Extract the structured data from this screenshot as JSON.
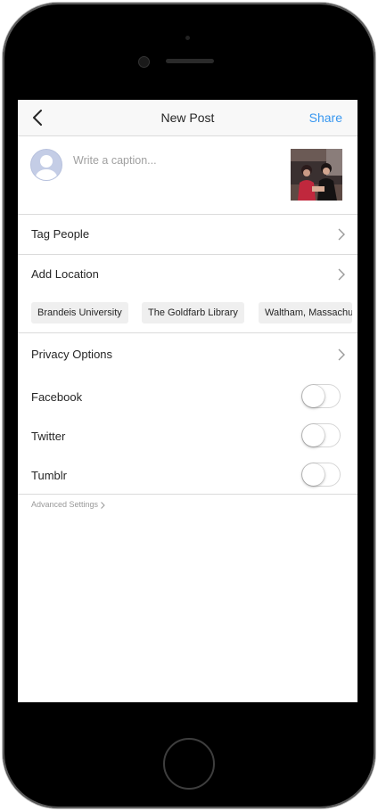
{
  "nav": {
    "title": "New Post",
    "share_label": "Share"
  },
  "caption": {
    "placeholder": "Write a caption..."
  },
  "rows": {
    "tag_people": "Tag People",
    "add_location": "Add Location",
    "privacy_options": "Privacy Options"
  },
  "location_suggestions": [
    "Brandeis University",
    "The Goldfarb Library",
    "Waltham, Massachusetts"
  ],
  "share_targets": [
    {
      "label": "Facebook",
      "on": false
    },
    {
      "label": "Twitter",
      "on": false
    },
    {
      "label": "Tumblr",
      "on": false
    }
  ],
  "advanced_settings": "Advanced Settings",
  "colors": {
    "accent": "#3897f0",
    "text": "#262626",
    "placeholder": "#a0a0a0",
    "divider": "#dbdbdb"
  },
  "icons": [
    "back-chevron-icon",
    "chevron-right-icon",
    "avatar-placeholder-icon"
  ]
}
